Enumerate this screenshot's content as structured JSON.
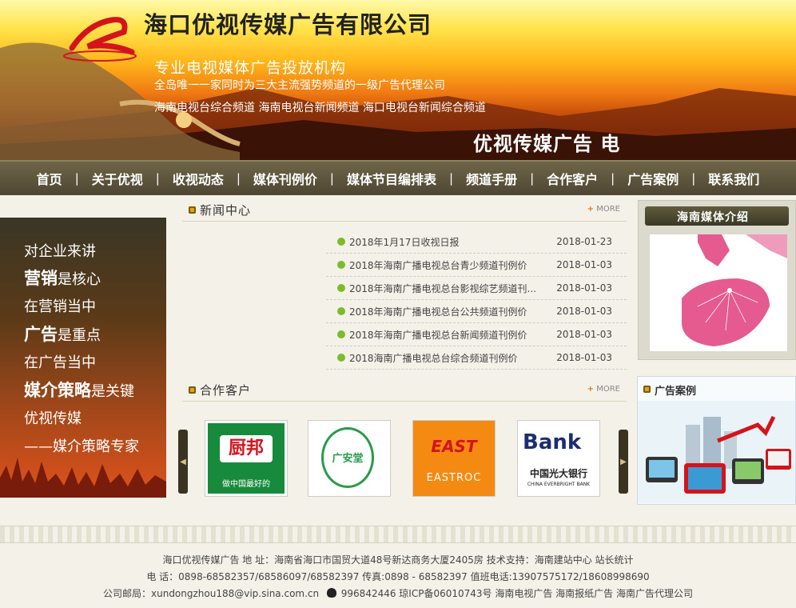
{
  "banner": {
    "company": "海口优视传媒广告有限公司",
    "slogan1": "专业电视媒体广告投放机构",
    "slogan2": "全岛唯一一家同时为三大主流强势频道的一级广告代理公司",
    "slogan3": "海南电视台综合频道  海南电视台新闻频道  海口电视台新闻综合频道",
    "tagline": "优视传媒广告   电"
  },
  "nav": {
    "items": [
      "首页",
      "关于优视",
      "收视动态",
      "媒体刊例价",
      "媒体节目编排表",
      "频道手册",
      "合作客户",
      "广告案例",
      "联系我们"
    ],
    "separator": "|"
  },
  "left_panel": {
    "line1": "对企业来讲",
    "line2_big": "营销",
    "line2_rest": "是核心",
    "line3": "在营销当中",
    "line4_big": "广告",
    "line4_rest": "是重点",
    "line5": "在广告当中",
    "line6_big": "媒介策略",
    "line6_rest": "是关键",
    "line7": "优视传媒",
    "line8": "——媒介策略专家"
  },
  "news": {
    "heading": "新闻中心",
    "more": "MORE",
    "more_plus": "+",
    "items": [
      {
        "title": "2018年1月17日收视日报",
        "date": "2018-01-23"
      },
      {
        "title": "2018年海南广播电视总台青少频道刊例价",
        "date": "2018-01-03"
      },
      {
        "title": "2018年海南广播电视总台影视综艺频道刊...",
        "date": "2018-01-03"
      },
      {
        "title": "2018年海南广播电视总台公共频道刊例价",
        "date": "2018-01-03"
      },
      {
        "title": "2018年海南广播电视总台新闻频道刊例价",
        "date": "2018-01-03"
      },
      {
        "title": "2018海南广播电视总台综合频道刊例价",
        "date": "2018-01-03"
      }
    ]
  },
  "clients": {
    "heading": "合作客户",
    "more": "MORE",
    "more_plus": "+",
    "logo1": {
      "name": "厨邦",
      "sub": "做中国最好的"
    },
    "logo2": {
      "name": "广安堂"
    },
    "logo3": {
      "name": "EASTROC"
    },
    "logo4": {
      "name": "Bank",
      "cn": "中国光大银行",
      "en": "CHINA EVERBRIGHT BANK"
    }
  },
  "media": {
    "heading": "海南媒体介绍"
  },
  "cases": {
    "heading": "广告案例"
  },
  "footer": {
    "line1": "海口优视传媒广告   地 址：海南省海口市国贸大道48号新达商务大厦2405房   技术支持：海南建站中心   站长统计",
    "line2": "电 话：0898-68582357/68586097/68582397     传真:0898 - 68582397     值班电话:13907575172/18608998690",
    "line3a": "公司邮局：xundongzhou188@vip.sina.com.cn",
    "line3b": "996842446   琼ICP备06010743号   海南电视广告   海南报纸广告   海南广告代理公司"
  },
  "colors": {
    "nav_bg": "#5a5239",
    "accent_orange": "#e07b16",
    "news_dot": "#7dbb2a"
  }
}
